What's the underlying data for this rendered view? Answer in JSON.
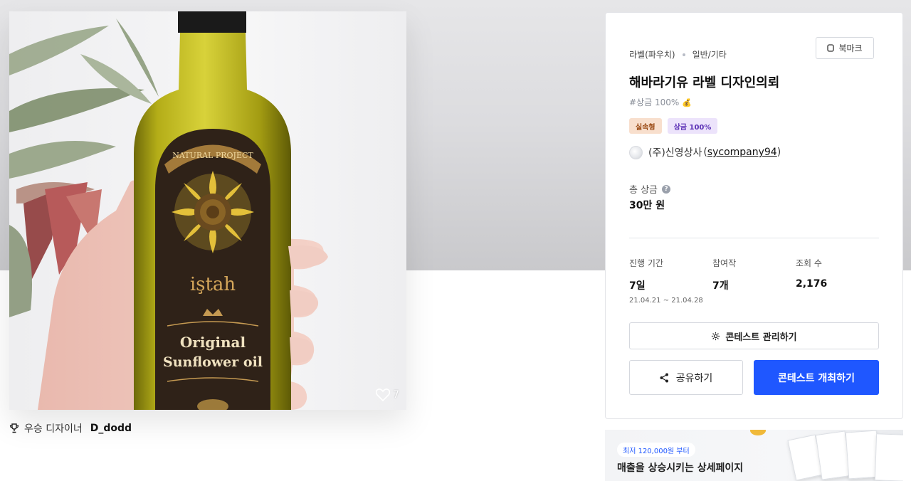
{
  "hero": {
    "likes": "7",
    "bottle_label_top": "NATURAL PROJECT",
    "bottle_brand": "iştah",
    "bottle_line1": "Original",
    "bottle_line2": "Sunflower oil"
  },
  "winner": {
    "label": "우승 디자이너",
    "name": "D_dodd"
  },
  "panel": {
    "category_primary": "라벨(파우치)",
    "category_secondary": "일반/기타",
    "bookmark_label": "북마크",
    "title": "해바라기유 라벨 디자인의뢰",
    "hashtag": "#상금 100%",
    "tags": [
      "실속형",
      "상금 100%"
    ],
    "host_name": "(주)신영상사",
    "host_id": "sycompany94",
    "prize_label": "총 상금",
    "prize_value": "30만 원",
    "stats": {
      "period_label": "진행 기간",
      "period_value": "7일",
      "period_range": "21.04.21 ~ 21.04.28",
      "entries_label": "참여작",
      "entries_value": "7개",
      "views_label": "조회 수",
      "views_value": "2,176"
    },
    "manage_button": "콘테스트 관리하기",
    "share_button": "공유하기",
    "open_button": "콘테스트 개최하기"
  },
  "ad": {
    "pill": "최저 120,000원 부터",
    "headline": "매출을 상승시키는 상세페이지"
  },
  "colors": {
    "primary": "#1f57ff",
    "tag_orange_bg": "#f8dfcd",
    "tag_purple_bg": "#ece3fb"
  }
}
